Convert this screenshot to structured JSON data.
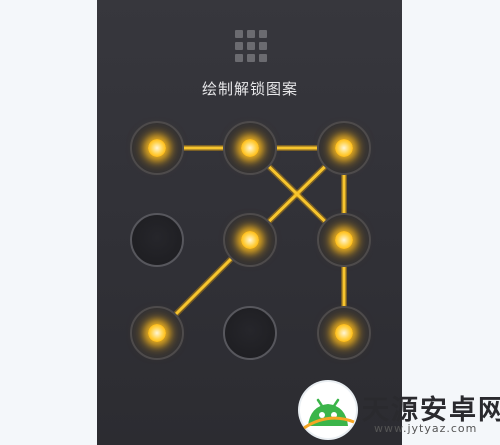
{
  "screen": {
    "title": "绘制解锁图案",
    "menu_icon": "grid-icon"
  },
  "pattern": {
    "nodes": [
      {
        "id": 1,
        "active": true
      },
      {
        "id": 2,
        "active": true
      },
      {
        "id": 3,
        "active": true
      },
      {
        "id": 4,
        "active": false
      },
      {
        "id": 5,
        "active": true
      },
      {
        "id": 6,
        "active": true
      },
      {
        "id": 7,
        "active": true
      },
      {
        "id": 8,
        "active": false
      },
      {
        "id": 9,
        "active": true
      }
    ],
    "path": [
      1,
      2,
      3,
      5,
      7
    ]
  },
  "extra_lines": [
    [
      2,
      6
    ],
    [
      3,
      6
    ],
    [
      6,
      9
    ]
  ],
  "colors": {
    "line": "#f7c52e",
    "glow": "#ffb300",
    "background": "#333338"
  },
  "watermark": {
    "name": "天源安卓网",
    "url": "www.jytyaz.com"
  }
}
